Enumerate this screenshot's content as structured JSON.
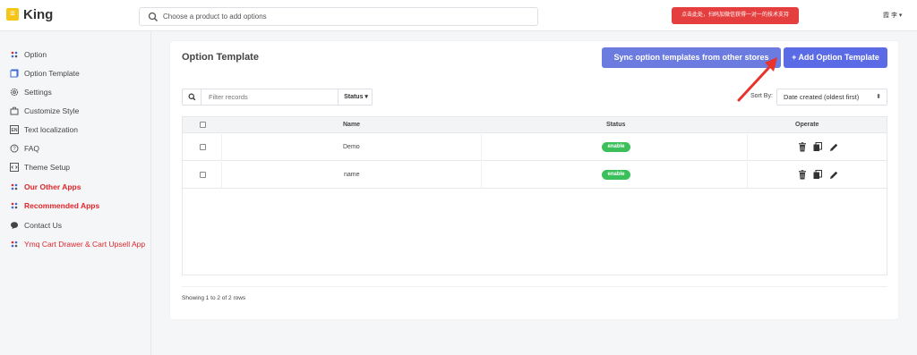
{
  "header": {
    "logo_glyph": "≡",
    "brand": "King",
    "search_placeholder": "Choose a product to add options",
    "promo_button": "点击此处，扫码加微信获得一对一的技术支持",
    "user": "霞 李 ▾"
  },
  "sidebar": {
    "items": [
      {
        "label": "Option",
        "icon": "dots-icon",
        "red": false
      },
      {
        "label": "Option Template",
        "icon": "template-icon",
        "red": false
      },
      {
        "label": "Settings",
        "icon": "gear-icon",
        "red": false
      },
      {
        "label": "Customize Style",
        "icon": "briefcase-icon",
        "red": false
      },
      {
        "label": "Text localization",
        "icon": "en-icon",
        "red": false
      },
      {
        "label": "FAQ",
        "icon": "question-icon",
        "red": false
      },
      {
        "label": "Theme Setup",
        "icon": "code-icon",
        "red": false
      },
      {
        "label": "Our Other Apps",
        "icon": "dots-icon",
        "red": true
      },
      {
        "label": "Recommended Apps",
        "icon": "dots-icon",
        "red": true
      },
      {
        "label": "Contact Us",
        "icon": "chat-icon",
        "red": false
      },
      {
        "label": "Ymq Cart Drawer & Cart Upsell App",
        "icon": "dots-icon",
        "red": false
      }
    ]
  },
  "main": {
    "title": "Option Template",
    "sync_button": "Sync option templates from other stores",
    "add_button": "+ Add Option Template",
    "filter_placeholder": "Filter records",
    "status_filter": "Status ▾",
    "sort_label": "Sort By:",
    "sort_value": "Date created (oldest first)",
    "columns": {
      "name": "Name",
      "status": "Status",
      "operate": "Operate"
    },
    "rows": [
      {
        "name": "Demo",
        "status": "enable"
      },
      {
        "name": "name",
        "status": "enable"
      }
    ],
    "footer": "Showing 1 to 2 of 2 rows"
  },
  "colors": {
    "accent": "#5b6be6",
    "promo": "#e43e3e",
    "enable": "#3bbf5a",
    "arrow": "#e8322b"
  }
}
